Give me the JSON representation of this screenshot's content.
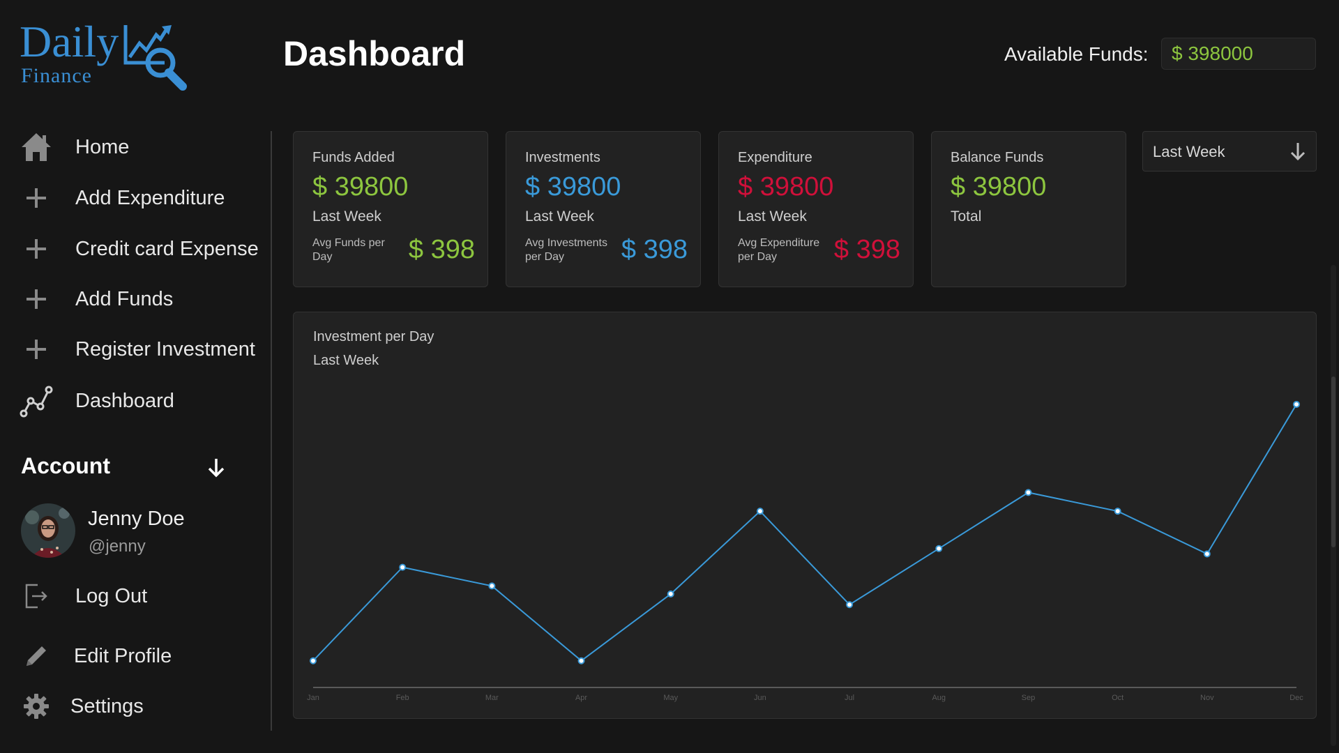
{
  "logo": {
    "line1": "Daily",
    "line2": "Finance"
  },
  "header": {
    "title": "Dashboard",
    "funds_label": "Available Funds:",
    "funds_value": "$ 398000"
  },
  "sidebar": {
    "items": [
      {
        "label": "Home",
        "icon": "home-icon"
      },
      {
        "label": "Add Expenditure",
        "icon": "plus-icon"
      },
      {
        "label": "Credit card Expense",
        "icon": "plus-icon"
      },
      {
        "label": "Add Funds",
        "icon": "plus-icon"
      },
      {
        "label": "Register Investment",
        "icon": "plus-icon"
      },
      {
        "label": "Dashboard",
        "icon": "line-chart-icon"
      }
    ],
    "account": {
      "title": "Account",
      "name": "Jenny Doe",
      "handle": "@jenny",
      "logout": "Log Out",
      "edit_profile": "Edit Profile",
      "settings": "Settings"
    }
  },
  "cards": [
    {
      "title": "Funds Added",
      "value": "$ 39800",
      "period": "Last Week",
      "avg_label": "Avg Funds per Day",
      "avg_value": "$ 398",
      "color": "#8dc63f"
    },
    {
      "title": "Investments",
      "value": "$ 39800",
      "period": "Last Week",
      "avg_label": "Avg Investments per Day",
      "avg_value": "$ 398",
      "color": "#3a9ad9"
    },
    {
      "title": "Expenditure",
      "value": "$ 39800",
      "period": "Last Week",
      "avg_label": "Avg Expenditure per Day",
      "avg_value": "$ 398",
      "color": "#d0103a"
    },
    {
      "title": "Balance Funds",
      "value": "$ 39800",
      "period": "Total",
      "color": "#8dc63f"
    }
  ],
  "period_select": {
    "value": "Last Week"
  },
  "chart_data": {
    "type": "line",
    "title": "Investment per Day",
    "subtitle": "Last Week",
    "categories": [
      "Jan",
      "Feb",
      "Mar",
      "Apr",
      "May",
      "Jun",
      "Jul",
      "Aug",
      "Sep",
      "Oct",
      "Nov",
      "Dec"
    ],
    "values": [
      10,
      45,
      38,
      10,
      35,
      66,
      31,
      52,
      73,
      66,
      50,
      106
    ],
    "ylim": [
      0,
      130
    ],
    "grid": false,
    "color": "#3a9ad9"
  }
}
